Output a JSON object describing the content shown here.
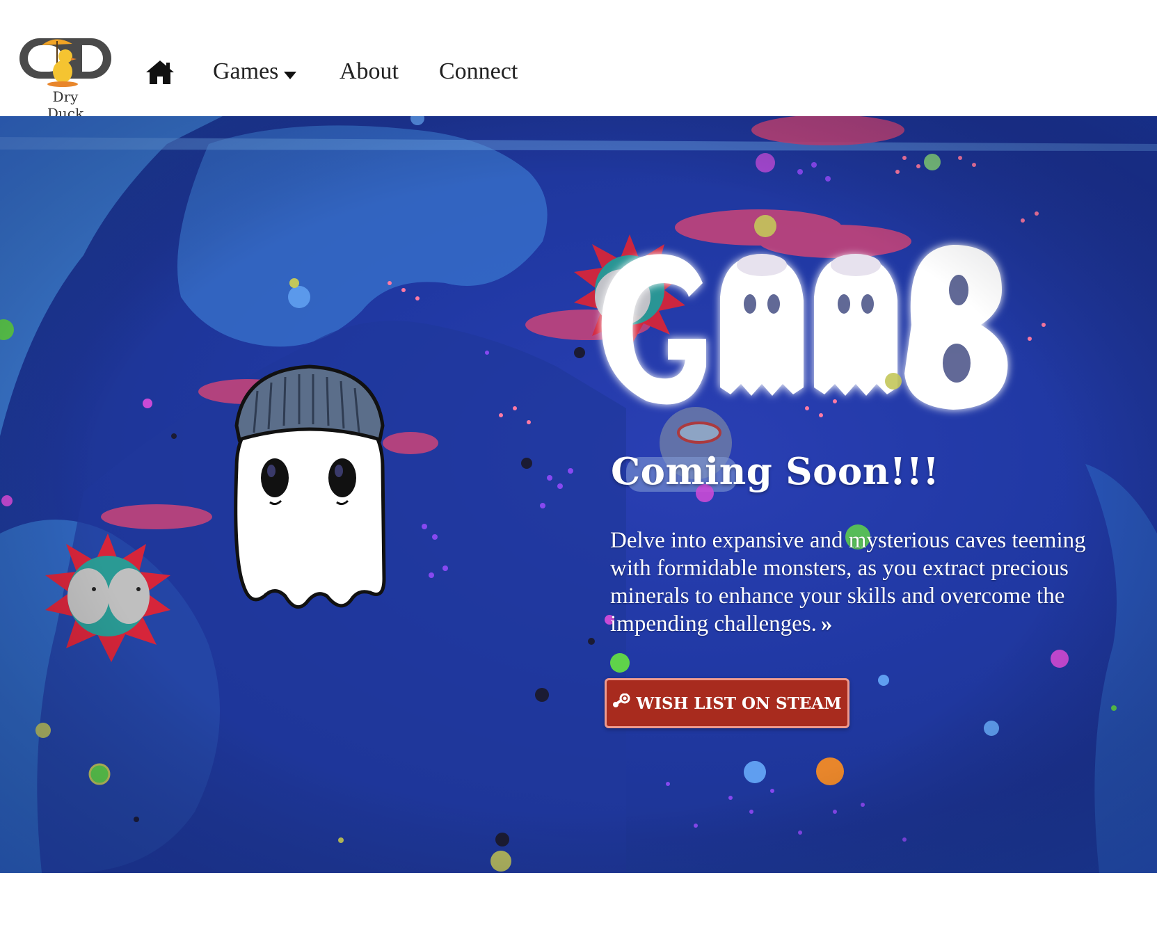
{
  "brand": {
    "name": "Dry Duck",
    "logo_icon": "duck-umbrella-logo"
  },
  "nav": {
    "home_icon": "home-icon",
    "games_label": "Games",
    "about_label": "About",
    "connect_label": "Connect"
  },
  "hero": {
    "game_logo": "GOOB",
    "heading": "Coming Soon!!!",
    "description": "Delve into expansive and mysterious caves teeming with formidable monsters, as you extract precious minerals to enhance your skills and overcome the impending challenges.",
    "more_icon": "double-chevron-right-icon",
    "cta_label": "WISH LIST ON STEAM",
    "cta_icon": "steam-icon"
  },
  "colors": {
    "cta_background": "#a82b1e",
    "cta_border": "#ef9a8d",
    "hero_background": "#2139a5",
    "nav_text": "#222222"
  }
}
